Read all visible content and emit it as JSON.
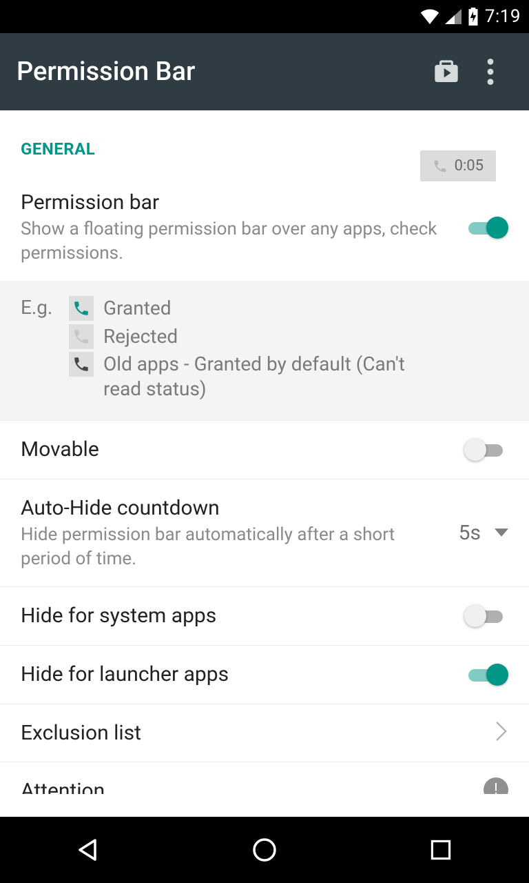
{
  "status": {
    "time": "7:19"
  },
  "appbar": {
    "title": "Permission Bar"
  },
  "section": {
    "general": "GENERAL"
  },
  "badge": {
    "text": "0:05"
  },
  "settings": {
    "permission_bar": {
      "title": "Permission bar",
      "desc": "Show a floating permission bar over any apps, check permissions.",
      "on": true
    },
    "movable": {
      "title": "Movable",
      "on": false
    },
    "auto_hide": {
      "title": "Auto-Hide countdown",
      "desc": "Hide permission bar automatically after a short period of time.",
      "value": "5s"
    },
    "hide_system": {
      "title": "Hide for system apps",
      "on": false
    },
    "hide_launcher": {
      "title": "Hide for launcher apps",
      "on": true
    },
    "exclusion": {
      "title": "Exclusion list"
    },
    "attention": {
      "title": "Attention"
    }
  },
  "example": {
    "label": "E.g.",
    "granted": "Granted",
    "rejected": "Rejected",
    "old": "Old apps - Granted by default (Can't read status)"
  }
}
